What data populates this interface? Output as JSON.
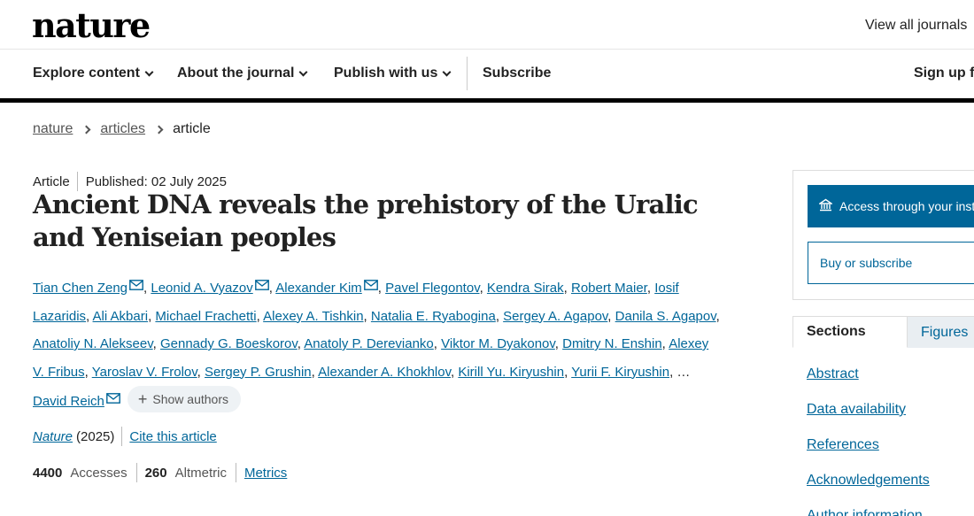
{
  "header": {
    "logo": "nature",
    "view_all": "View all journals"
  },
  "nav": {
    "items": [
      {
        "label": "Explore content",
        "dropdown": true
      },
      {
        "label": "About the journal",
        "dropdown": true
      },
      {
        "label": "Publish with us",
        "dropdown": true
      },
      {
        "label": "Subscribe",
        "dropdown": false
      }
    ],
    "signup": "Sign up f"
  },
  "breadcrumb": [
    "nature",
    "articles",
    "article"
  ],
  "article": {
    "type": "Article",
    "published": "Published: 02 July 2025",
    "title": "Ancient DNA reveals the prehistory of the Uralic and Yeniseian peoples",
    "authors": [
      {
        "name": "Tian Chen Zeng",
        "email": true
      },
      {
        "name": "Leonid A. Vyazov",
        "email": true
      },
      {
        "name": "Alexander Kim",
        "email": true
      },
      {
        "name": "Pavel Flegontov",
        "email": false
      },
      {
        "name": "Kendra Sirak",
        "email": false
      },
      {
        "name": "Robert Maier",
        "email": false
      },
      {
        "name": "Iosif Lazaridis",
        "email": false
      },
      {
        "name": "Ali Akbari",
        "email": false
      },
      {
        "name": "Michael Frachetti",
        "email": false
      },
      {
        "name": "Alexey A. Tishkin",
        "email": false
      },
      {
        "name": "Natalia E. Ryabogina",
        "email": false
      },
      {
        "name": "Sergey A. Agapov",
        "email": false
      },
      {
        "name": "Danila S. Agapov",
        "email": false
      },
      {
        "name": "Anatoliy N. Alekseev",
        "email": false
      },
      {
        "name": "Gennady G. Boeskorov",
        "email": false
      },
      {
        "name": "Anatoly P. Derevianko",
        "email": false
      },
      {
        "name": "Viktor M. Dyakonov",
        "email": false
      },
      {
        "name": "Dmitry N. Enshin",
        "email": false
      },
      {
        "name": "Alexey V. Fribus",
        "email": false
      },
      {
        "name": "Yaroslav V. Frolov",
        "email": false
      },
      {
        "name": "Sergey P. Grushin",
        "email": false
      },
      {
        "name": "Alexander A. Khokhlov",
        "email": false
      },
      {
        "name": "Kirill Yu. Kiryushin",
        "email": false
      },
      {
        "name": "Yurii F. Kiryushin",
        "email": false
      }
    ],
    "ellipsis": "…",
    "last_author": "David Reich",
    "show_authors": "Show authors",
    "journal": "Nature",
    "year": "(2025)",
    "cite": "Cite this article",
    "accesses_count": "4400",
    "accesses_label": "Accesses",
    "altmetric_count": "260",
    "altmetric_label": "Altmetric",
    "metrics_link": "Metrics"
  },
  "sidebar": {
    "access_button": "Access through your institution",
    "buy_button": "Buy or subscribe",
    "tabs": [
      "Sections",
      "Figures"
    ],
    "sections": [
      "Abstract",
      "Data availability",
      "References",
      "Acknowledgements",
      "Author information"
    ]
  },
  "colors": {
    "link": "#006699",
    "accent": "#006699"
  }
}
